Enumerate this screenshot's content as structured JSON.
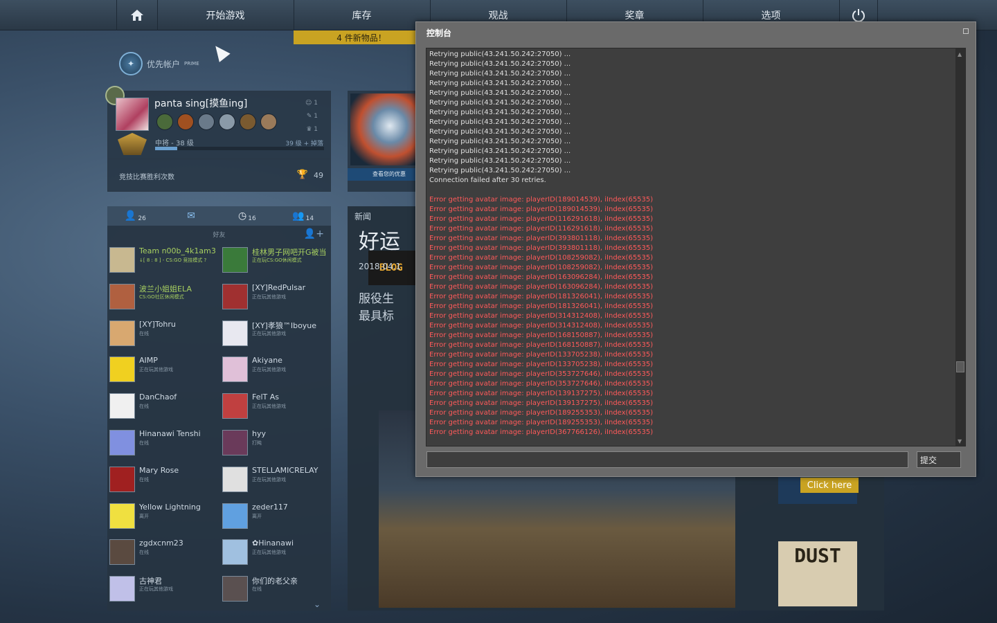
{
  "nav": {
    "play": "开始游戏",
    "inventory": "库存",
    "watch": "观战",
    "medals": "奖章",
    "options": "选项",
    "new_items": "4 件新物品！"
  },
  "prime": {
    "label": "优先帐户",
    "sub": "PRIME"
  },
  "profile": {
    "name": "panta sing[摸鱼ing]",
    "rank": "中将 - 38 级",
    "xp": "39 级 + 掉落",
    "xp_progress": 0.13,
    "stat1": "1",
    "stat2": "1",
    "stat3": "1",
    "wins_label": "竞技比赛胜利次数",
    "wins": "49"
  },
  "coupon": {
    "label": "查看您的优惠"
  },
  "friends_panel": {
    "tab_friends_count": "26",
    "tab_recent_count": "16",
    "tab_groups_count": "14",
    "header": "好友",
    "friends": [
      {
        "name": "Team n00b_4k1am3",
        "status": "↓[ 8 : 8 ] - CS:GO 竞技模式 ?",
        "ingame": true
      },
      {
        "name": "桂林男子网吧开G被当",
        "status": "正在玩CS:GO休闲模式",
        "ingame": true
      },
      {
        "name": "波兰小姐姐ELA",
        "status": "CS:GO社区休闲模式",
        "ingame": true
      },
      {
        "name": "[XY]RedPulsar",
        "status": "正在玩其他游戏",
        "ingame": false
      },
      {
        "name": "[XY]Tohru",
        "status": "在线",
        "ingame": false
      },
      {
        "name": "[XY]孝狼™Iboyue",
        "status": "正在玩其他游戏",
        "ingame": false
      },
      {
        "name": "AIMP",
        "status": "正在玩其他游戏",
        "ingame": false
      },
      {
        "name": "Akiyane",
        "status": "正在玩其他游戏",
        "ingame": false
      },
      {
        "name": "DanChaof",
        "status": "在线",
        "ingame": false
      },
      {
        "name": "FelT As",
        "status": "正在玩其他游戏",
        "ingame": false
      },
      {
        "name": "Hinanawi Tenshi",
        "status": "在线",
        "ingame": false
      },
      {
        "name": "hyy",
        "status": "打盹",
        "ingame": false
      },
      {
        "name": "Mary Rose",
        "status": "在线",
        "ingame": false
      },
      {
        "name": "STELLAMICRELAY",
        "status": "正在玩其他游戏",
        "ingame": false
      },
      {
        "name": "Yellow Lightning",
        "status": "离开",
        "ingame": false
      },
      {
        "name": "zeder117",
        "status": "离开",
        "ingame": false
      },
      {
        "name": "zgdxcnm23",
        "status": "在线",
        "ingame": false
      },
      {
        "name": "✿Hinanawi",
        "status": "正在玩其他游戏",
        "ingame": false
      },
      {
        "name": "古神君",
        "status": "正在玩其他游戏",
        "ingame": false
      },
      {
        "name": "你们的老父亲",
        "status": "在线",
        "ingame": false
      }
    ]
  },
  "news": {
    "title": "新闻",
    "blog": "BLOG",
    "article_title": "好运",
    "article_date": "2018.04.1",
    "article_line1": "服役生",
    "article_line2": "最具标",
    "ad_click": "Click here",
    "dust": "DUST"
  },
  "console": {
    "title": "控制台",
    "submit": "提交",
    "input_value": "",
    "lines": [
      {
        "t": "Retrying public(43.241.50.242:27050) ...",
        "e": false
      },
      {
        "t": "Retrying public(43.241.50.242:27050) ...",
        "e": false
      },
      {
        "t": "Retrying public(43.241.50.242:27050) ...",
        "e": false
      },
      {
        "t": "Retrying public(43.241.50.242:27050) ...",
        "e": false
      },
      {
        "t": "Retrying public(43.241.50.242:27050) ...",
        "e": false
      },
      {
        "t": "Retrying public(43.241.50.242:27050) ...",
        "e": false
      },
      {
        "t": "Retrying public(43.241.50.242:27050) ...",
        "e": false
      },
      {
        "t": "Retrying public(43.241.50.242:27050) ...",
        "e": false
      },
      {
        "t": "Retrying public(43.241.50.242:27050) ...",
        "e": false
      },
      {
        "t": "Retrying public(43.241.50.242:27050) ...",
        "e": false
      },
      {
        "t": "Retrying public(43.241.50.242:27050) ...",
        "e": false
      },
      {
        "t": "Retrying public(43.241.50.242:27050) ...",
        "e": false
      },
      {
        "t": "Retrying public(43.241.50.242:27050) ...",
        "e": false
      },
      {
        "t": "Connection failed after 30 retries.",
        "e": false
      },
      {
        "t": "",
        "e": false
      },
      {
        "t": "Error getting avatar image: playerID(189014539), iIndex(65535)",
        "e": true
      },
      {
        "t": "Error getting avatar image: playerID(189014539), iIndex(65535)",
        "e": true
      },
      {
        "t": "Error getting avatar image: playerID(116291618), iIndex(65535)",
        "e": true
      },
      {
        "t": "Error getting avatar image: playerID(116291618), iIndex(65535)",
        "e": true
      },
      {
        "t": "Error getting avatar image: playerID(393801118), iIndex(65535)",
        "e": true
      },
      {
        "t": "Error getting avatar image: playerID(393801118), iIndex(65535)",
        "e": true
      },
      {
        "t": "Error getting avatar image: playerID(108259082), iIndex(65535)",
        "e": true
      },
      {
        "t": "Error getting avatar image: playerID(108259082), iIndex(65535)",
        "e": true
      },
      {
        "t": "Error getting avatar image: playerID(163096284), iIndex(65535)",
        "e": true
      },
      {
        "t": "Error getting avatar image: playerID(163096284), iIndex(65535)",
        "e": true
      },
      {
        "t": "Error getting avatar image: playerID(181326041), iIndex(65535)",
        "e": true
      },
      {
        "t": "Error getting avatar image: playerID(181326041), iIndex(65535)",
        "e": true
      },
      {
        "t": "Error getting avatar image: playerID(314312408), iIndex(65535)",
        "e": true
      },
      {
        "t": "Error getting avatar image: playerID(314312408), iIndex(65535)",
        "e": true
      },
      {
        "t": "Error getting avatar image: playerID(168150887), iIndex(65535)",
        "e": true
      },
      {
        "t": "Error getting avatar image: playerID(168150887), iIndex(65535)",
        "e": true
      },
      {
        "t": "Error getting avatar image: playerID(133705238), iIndex(65535)",
        "e": true
      },
      {
        "t": "Error getting avatar image: playerID(133705238), iIndex(65535)",
        "e": true
      },
      {
        "t": "Error getting avatar image: playerID(353727646), iIndex(65535)",
        "e": true
      },
      {
        "t": "Error getting avatar image: playerID(353727646), iIndex(65535)",
        "e": true
      },
      {
        "t": "Error getting avatar image: playerID(139137275), iIndex(65535)",
        "e": true
      },
      {
        "t": "Error getting avatar image: playerID(139137275), iIndex(65535)",
        "e": true
      },
      {
        "t": "Error getting avatar image: playerID(189255353), iIndex(65535)",
        "e": true
      },
      {
        "t": "Error getting avatar image: playerID(189255353), iIndex(65535)",
        "e": true
      },
      {
        "t": "Error getting avatar image: playerID(367766126), iIndex(65535)",
        "e": true
      }
    ]
  },
  "colors": {
    "accent_gold": "#c9a322",
    "ingame_green": "#a8d060",
    "error_red": "#ff5a5a"
  },
  "icons": {
    "home": "home-icon",
    "power": "power-icon",
    "friends": "person-icon",
    "mail": "mail-icon",
    "recent": "clock-icon",
    "groups": "group-icon",
    "add_friend": "add-friend-icon",
    "trophy": "trophy-icon"
  }
}
